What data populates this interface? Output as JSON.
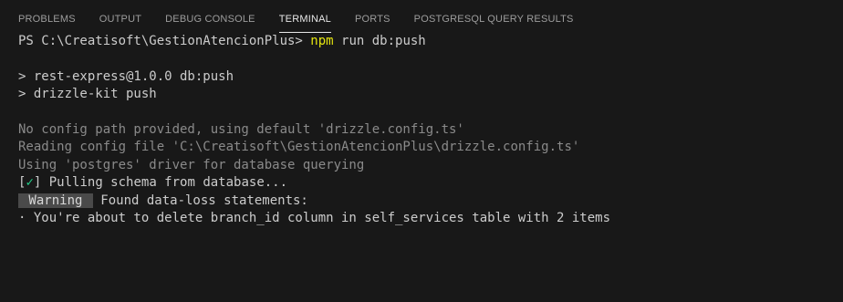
{
  "tabs": [
    {
      "label": "PROBLEMS",
      "active": false
    },
    {
      "label": "OUTPUT",
      "active": false
    },
    {
      "label": "DEBUG CONSOLE",
      "active": false
    },
    {
      "label": "TERMINAL",
      "active": true
    },
    {
      "label": "PORTS",
      "active": false
    },
    {
      "label": "POSTGRESQL QUERY RESULTS",
      "active": false
    }
  ],
  "terminal": {
    "prompt": "PS C:\\Creatisoft\\GestionAtencionPlus> ",
    "cmd_npm": "npm",
    "cmd_args": " run db:push",
    "script_line1": "> rest-express@1.0.0 db:push",
    "script_line2": "> drizzle-kit push",
    "info1": "No config path provided, using default 'drizzle.config.ts'",
    "info2": "Reading config file 'C:\\Creatisoft\\GestionAtencionPlus\\drizzle.config.ts'",
    "info3": "Using 'postgres' driver for database querying",
    "pull_open": "[",
    "pull_check": "✓",
    "pull_close": "]",
    "pull_text": " Pulling schema from database...",
    "warning_badge": " Warning ",
    "warning_text": " Found data-loss statements:",
    "delete_line": "· You're about to delete branch_id column in self_services table with 2 items"
  },
  "colors": {
    "background": "#181818",
    "prompt_cmd": "#e5e510",
    "success": "#23d18b",
    "dim_text": "#8a8a8a"
  }
}
